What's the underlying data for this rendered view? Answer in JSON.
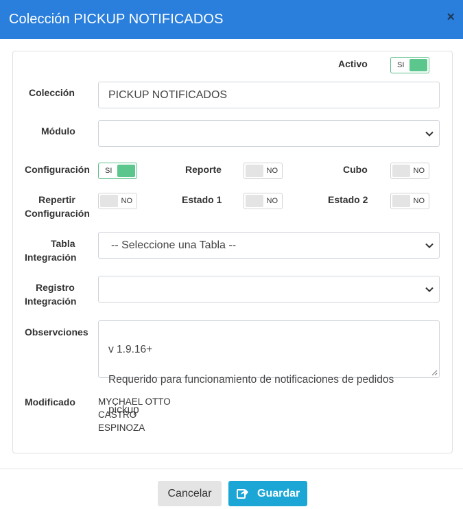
{
  "dialog": {
    "title": "Colección PICKUP NOTIFICADOS",
    "close_icon": "×"
  },
  "form": {
    "activo": {
      "label": "Activo",
      "state": "SI"
    },
    "coleccion": {
      "label": "Colección",
      "value": "PICKUP NOTIFICADOS"
    },
    "modulo": {
      "label": "Módulo",
      "value": ""
    },
    "configuracion": {
      "label": "Configuración",
      "state": "SI"
    },
    "reporte": {
      "label": "Reporte",
      "state": "NO"
    },
    "cubo": {
      "label": "Cubo",
      "state": "NO"
    },
    "repertir_configuracion": {
      "label_line1": "Repertir",
      "label_line2": "Configuración",
      "state": "NO"
    },
    "estado1": {
      "label": "Estado 1",
      "state": "NO"
    },
    "estado2": {
      "label": "Estado 2",
      "state": "NO"
    },
    "tabla_integracion": {
      "label_line1": "Tabla",
      "label_line2": "Integración",
      "value": "-- Seleccione una Tabla --"
    },
    "registro_integracion": {
      "label_line1": "Registro",
      "label_line2": "Integración",
      "value": ""
    },
    "observaciones": {
      "label": "Observciones",
      "line1": "v 1.9.16+",
      "line2": "Requerido para funcionamiento de notificaciones de pedidos",
      "line3": "pickup"
    },
    "modificado": {
      "label": "Modificado",
      "line1": "MYCHAEL OTTO",
      "line2": "CASTRO",
      "line3": "ESPINOZA"
    }
  },
  "footer": {
    "cancel_label": "Cancelar",
    "save_label": "Guardar",
    "save_icon": "share-icon"
  },
  "colors": {
    "header": "#2a7fdc",
    "toggle_on": "#5cc78d",
    "save_button": "#1ba6d6"
  }
}
